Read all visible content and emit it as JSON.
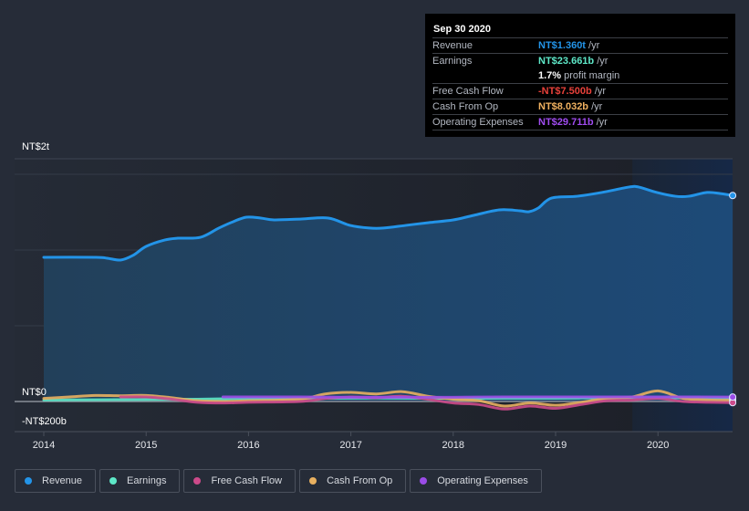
{
  "tooltip": {
    "date": "Sep 30 2020",
    "rows": [
      {
        "label": "Revenue",
        "value": "NT$1.360t",
        "unit": " /yr",
        "color": "#2394e8"
      },
      {
        "label": "Earnings",
        "value": "NT$23.661b",
        "unit": " /yr",
        "color": "#5ee8c8"
      },
      {
        "label": "",
        "value": "1.7%",
        "unit": " profit margin",
        "color": "#ffffff"
      },
      {
        "label": "Free Cash Flow",
        "value": "-NT$7.500b",
        "unit": " /yr",
        "color": "#e8413a"
      },
      {
        "label": "Cash From Op",
        "value": "NT$8.032b",
        "unit": " /yr",
        "color": "#f0b160"
      },
      {
        "label": "Operating Expenses",
        "value": "NT$29.711b",
        "unit": " /yr",
        "color": "#a04cf0"
      }
    ]
  },
  "legend": [
    {
      "label": "Revenue",
      "color": "#2394e8"
    },
    {
      "label": "Earnings",
      "color": "#5ee8c8"
    },
    {
      "label": "Free Cash Flow",
      "color": "#cc4a8a"
    },
    {
      "label": "Cash From Op",
      "color": "#e8b060"
    },
    {
      "label": "Operating Expenses",
      "color": "#9b4ce8"
    }
  ],
  "chart_data": {
    "type": "area",
    "title": "",
    "xlabel": "",
    "ylabel": "",
    "y_unit": "NT$ trillions",
    "y_top_label": "NT$2t",
    "y_zero_label": "NT$0",
    "y_bottom_label": "-NT$200b",
    "ylim": [
      -0.2,
      1.6
    ],
    "xlim": [
      2013.7,
      2020.75
    ],
    "x_ticks": [
      "2014",
      "2015",
      "2016",
      "2017",
      "2018",
      "2019",
      "2020"
    ],
    "grid": true,
    "highlight_from": 2019.75,
    "legend_position": "bottom-left",
    "series": [
      {
        "name": "Revenue",
        "color": "#2394e8",
        "filled": true,
        "x": [
          2014.0,
          2014.51,
          2014.62,
          2014.75,
          2014.87,
          2015.0,
          2015.18,
          2015.31,
          2015.53,
          2015.71,
          2015.85,
          2015.98,
          2016.12,
          2016.25,
          2016.52,
          2016.78,
          2016.99,
          2017.18,
          2017.32,
          2017.54,
          2017.76,
          2018.0,
          2018.2,
          2018.45,
          2018.65,
          2018.74,
          2018.83,
          2018.96,
          2019.21,
          2019.45,
          2019.72,
          2019.81,
          2019.99,
          2020.17,
          2020.3,
          2020.48,
          2020.61,
          2020.73
        ],
        "values": [
          0.952,
          0.952,
          0.946,
          0.934,
          0.964,
          1.024,
          1.066,
          1.078,
          1.084,
          1.145,
          1.187,
          1.217,
          1.211,
          1.199,
          1.205,
          1.211,
          1.163,
          1.145,
          1.145,
          1.163,
          1.181,
          1.199,
          1.229,
          1.265,
          1.259,
          1.253,
          1.277,
          1.343,
          1.355,
          1.38,
          1.416,
          1.416,
          1.38,
          1.355,
          1.355,
          1.38,
          1.373,
          1.36
        ]
      },
      {
        "name": "Earnings",
        "color": "#5ee8c8",
        "x": [
          2014.0,
          2014.75,
          2015.5,
          2016.0,
          2016.5,
          2017.0,
          2017.5,
          2018.0,
          2018.5,
          2019.0,
          2019.5,
          2020.0,
          2020.73
        ],
        "values": [
          0.01,
          0.012,
          0.015,
          0.02,
          0.02,
          0.022,
          0.022,
          0.02,
          0.022,
          0.022,
          0.024,
          0.024,
          0.0237
        ]
      },
      {
        "name": "Free Cash Flow",
        "color": "#cc4a8a",
        "x": [
          2014.75,
          2015.0,
          2015.25,
          2015.5,
          2015.75,
          2016.0,
          2016.5,
          2016.75,
          2017.0,
          2017.25,
          2017.5,
          2017.75,
          2018.0,
          2018.25,
          2018.5,
          2018.75,
          2019.0,
          2019.25,
          2019.5,
          2019.75,
          2020.0,
          2020.25,
          2020.5,
          2020.73
        ],
        "values": [
          0.03,
          0.03,
          0.015,
          -0.005,
          -0.01,
          -0.005,
          0.0,
          0.02,
          0.03,
          0.025,
          0.035,
          0.015,
          -0.01,
          -0.02,
          -0.05,
          -0.03,
          -0.045,
          -0.02,
          0.005,
          0.01,
          0.02,
          0.0,
          -0.005,
          -0.0075
        ]
      },
      {
        "name": "Cash From Op",
        "color": "#e8b060",
        "x": [
          2014.0,
          2014.25,
          2014.5,
          2014.75,
          2015.0,
          2015.25,
          2015.5,
          2015.75,
          2016.0,
          2016.5,
          2016.75,
          2017.0,
          2017.25,
          2017.5,
          2017.75,
          2018.0,
          2018.25,
          2018.5,
          2018.75,
          2019.0,
          2019.25,
          2019.5,
          2019.75,
          2020.0,
          2020.25,
          2020.5,
          2020.73
        ],
        "values": [
          0.02,
          0.03,
          0.04,
          0.038,
          0.04,
          0.025,
          0.005,
          0.0,
          0.005,
          0.015,
          0.05,
          0.06,
          0.05,
          0.065,
          0.035,
          0.015,
          0.005,
          -0.03,
          -0.01,
          -0.025,
          -0.005,
          0.02,
          0.03,
          0.07,
          0.02,
          0.01,
          0.008
        ]
      },
      {
        "name": "Operating Expenses",
        "color": "#9b4ce8",
        "x": [
          2015.75,
          2016.5,
          2017.0,
          2017.5,
          2018.0,
          2018.5,
          2019.0,
          2019.5,
          2020.0,
          2020.73
        ],
        "values": [
          0.03,
          0.03,
          0.028,
          0.028,
          0.028,
          0.03,
          0.03,
          0.03,
          0.03,
          0.0297
        ]
      }
    ]
  }
}
